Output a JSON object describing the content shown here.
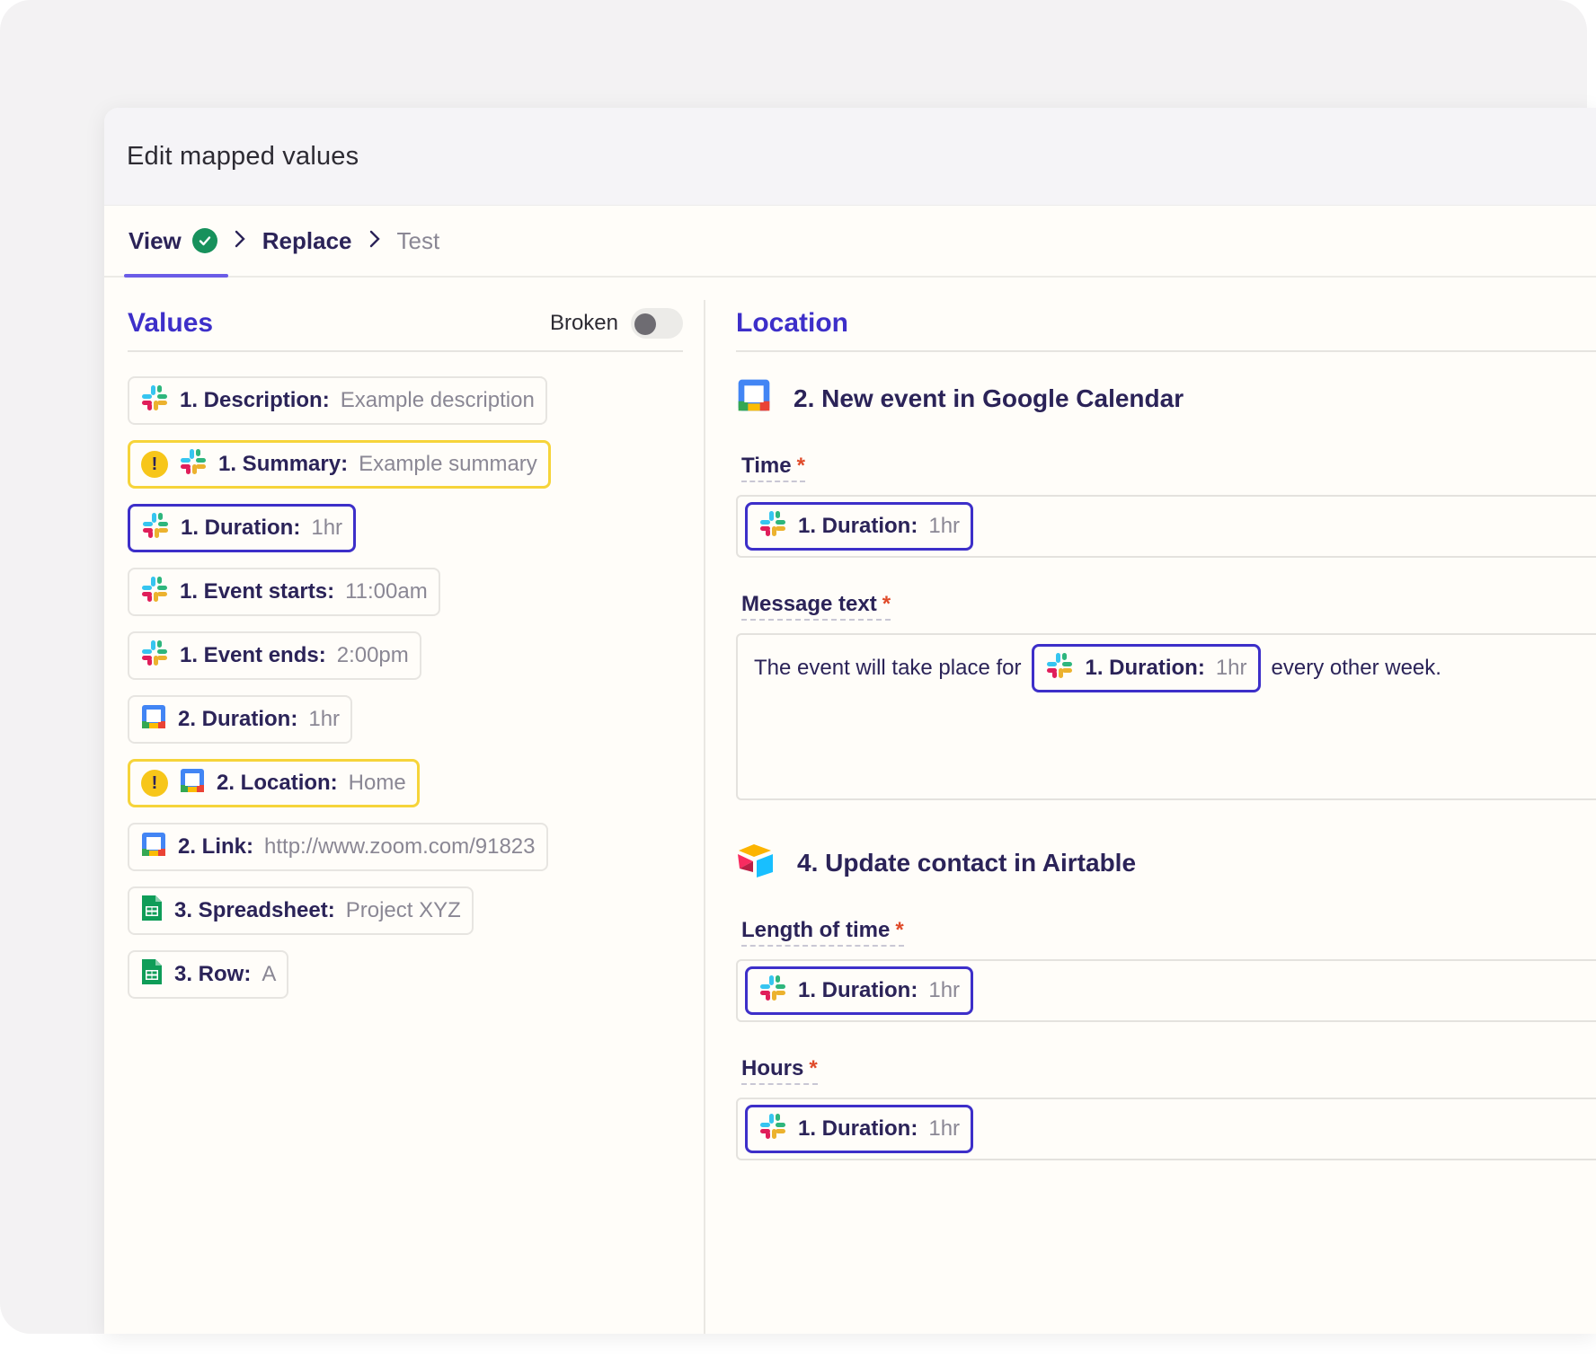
{
  "dialog": {
    "title": "Edit mapped values"
  },
  "steps": [
    {
      "label": "View"
    },
    {
      "label": "Replace"
    },
    {
      "label": "Test"
    }
  ],
  "values_panel": {
    "heading": "Values",
    "toggle_label": "Broken",
    "toggle_on": false,
    "items": [
      {
        "icon": "slack-icon",
        "key": "1. Description:",
        "value": "Example description",
        "state": "normal"
      },
      {
        "icon": "slack-icon",
        "key": "1. Summary:",
        "value": "Example summary",
        "state": "warning"
      },
      {
        "icon": "slack-icon",
        "key": "1. Duration:",
        "value": "1hr",
        "state": "selected"
      },
      {
        "icon": "slack-icon",
        "key": "1. Event starts:",
        "value": "11:00am",
        "state": "normal"
      },
      {
        "icon": "slack-icon",
        "key": "1. Event ends:",
        "value": "2:00pm",
        "state": "normal"
      },
      {
        "icon": "google-calendar-icon",
        "key": "2. Duration:",
        "value": "1hr",
        "state": "normal"
      },
      {
        "icon": "google-calendar-icon",
        "key": "2. Location:",
        "value": "Home",
        "state": "warning"
      },
      {
        "icon": "google-calendar-icon",
        "key": "2. Link:",
        "value": "http://www.zoom.com/91823",
        "state": "normal"
      },
      {
        "icon": "google-sheets-icon",
        "key": "3. Spreadsheet:",
        "value": "Project XYZ",
        "state": "normal"
      },
      {
        "icon": "google-sheets-icon",
        "key": "3. Row:",
        "value": "A",
        "state": "normal"
      }
    ]
  },
  "location_panel": {
    "heading": "Location",
    "apps": [
      {
        "icon": "google-calendar-icon",
        "title": "2. New event in Google Calendar",
        "fields": [
          {
            "label": "Time",
            "required": "*",
            "pill": {
              "key": "1. Duration:",
              "value": "1hr"
            }
          },
          {
            "label": "Message text",
            "required": "*",
            "before": "The event will take place for",
            "pill": {
              "key": "1. Duration:",
              "value": "1hr"
            },
            "after": "every other week."
          }
        ]
      },
      {
        "icon": "airtable-icon",
        "title": "4. Update contact in Airtable",
        "fields": [
          {
            "label": "Length of time",
            "required": "*",
            "pill": {
              "key": "1. Duration:",
              "value": "1hr"
            }
          },
          {
            "label": "Hours",
            "required": "*",
            "pill": {
              "key": "1. Duration:",
              "value": "1hr"
            }
          }
        ]
      }
    ]
  },
  "colors": {
    "accent": "#3d2fc9",
    "warning": "#f6d43a",
    "success": "#17915c",
    "required": "#e04b2a"
  }
}
